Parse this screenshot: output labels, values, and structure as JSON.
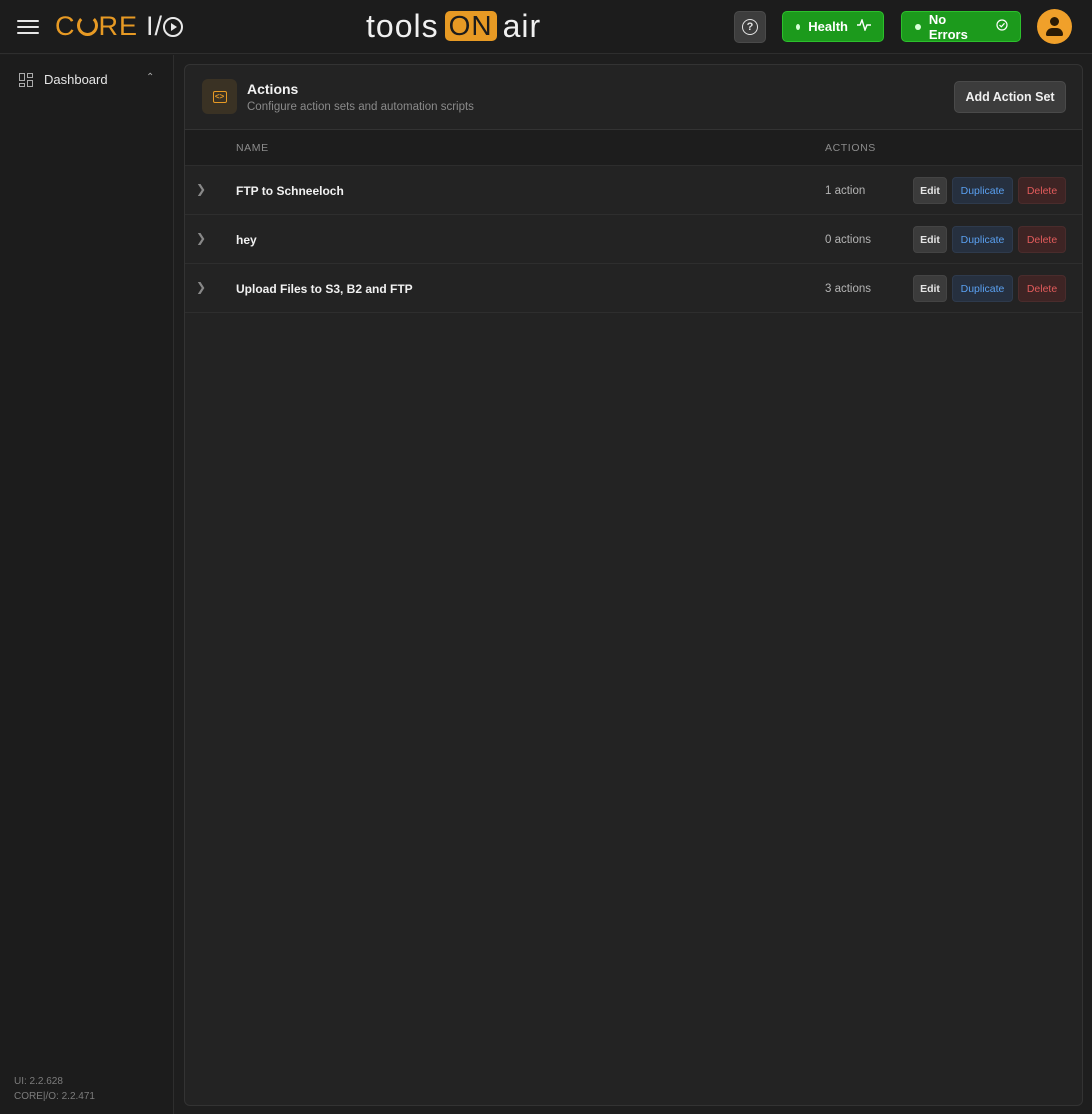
{
  "header": {
    "brand_core": "C",
    "brand_re": "RE",
    "brand_io_i": "I/",
    "partner_tools": "tools",
    "partner_on": "ON",
    "partner_air": "air",
    "help_label": "?",
    "health_label": "Health",
    "errors_label": "No Errors",
    "health_icon": "pulse-icon",
    "errors_icon": "check-circle-icon"
  },
  "sidebar": {
    "items": [
      {
        "label": "Dashboard",
        "icon": "grid-icon"
      }
    ],
    "ui_version": "UI: 2.2.628",
    "core_version": "CORE|/O: 2.2.471"
  },
  "main": {
    "title": "Actions",
    "subtitle": "Configure action sets and automation scripts",
    "add_button": "Add Action Set",
    "columns": {
      "name": "NAME",
      "actions": "ACTIONS"
    },
    "rows": [
      {
        "name": "FTP to Schneeloch",
        "count": "1 action",
        "edit": "Edit",
        "duplicate": "Duplicate",
        "delete": "Delete"
      },
      {
        "name": "hey",
        "count": "0 actions",
        "edit": "Edit",
        "duplicate": "Duplicate",
        "delete": "Delete"
      },
      {
        "name": "Upload Files to S3, B2 and FTP",
        "count": "3 actions",
        "edit": "Edit",
        "duplicate": "Duplicate",
        "delete": "Delete"
      }
    ]
  },
  "colors": {
    "accent": "#e79a24",
    "status_green": "#1c9a1c",
    "duplicate_blue": "#5aa0f0",
    "delete_red": "#e25b5b"
  }
}
